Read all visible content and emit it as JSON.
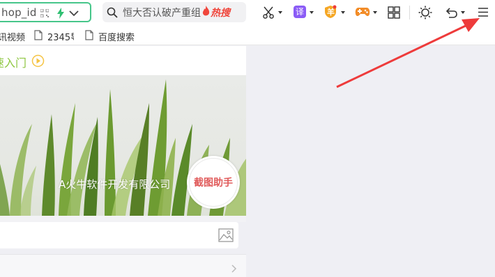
{
  "toolbar": {
    "address_text": "hop_id",
    "search_text": "恒大否认破产重组",
    "hot_label": "热搜",
    "icons": [
      "qr-code-icon",
      "lightning-icon",
      "chevron-down-icon",
      "search-icon",
      "flame-icon",
      "scissors-icon",
      "translate-icon",
      "coin-icon",
      "gamepad-icon",
      "apps-grid-icon",
      "brightness-icon",
      "undo-icon",
      "menu-icon"
    ],
    "translate_label": "译",
    "coin_label": "羊"
  },
  "bookmarks": [
    {
      "label": "讯视频"
    },
    {
      "label": "2345导"
    },
    {
      "label": "百度搜索"
    }
  ],
  "content": {
    "section_title": "速入门",
    "banner_text": "A火牛软件开发有限公司",
    "stamp_text": "截图助手"
  },
  "colors": {
    "address_border": "#46c68a",
    "hot": "#f0463c",
    "title_green": "#8dc63f",
    "stamp_red": "#e05a5a",
    "arrow_red": "#ee3b3b",
    "translate_purple": "#8b5cf6",
    "coin_orange": "#f5a623",
    "game_orange": "#f28c28"
  }
}
